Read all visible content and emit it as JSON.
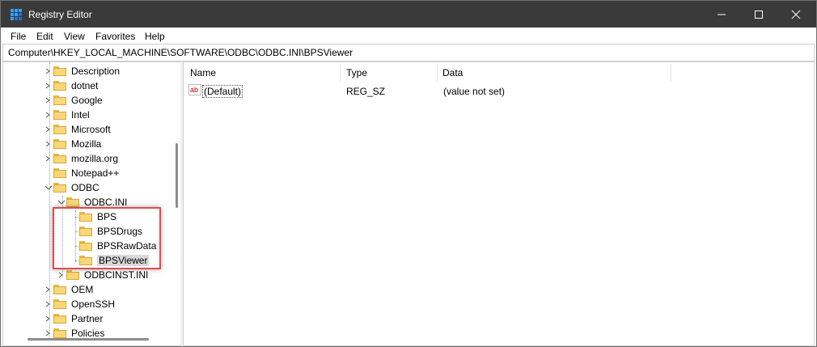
{
  "window": {
    "title": "Registry Editor"
  },
  "menu": [
    "File",
    "Edit",
    "View",
    "Favorites",
    "Help"
  ],
  "address": {
    "path": "Computer\\HKEY_LOCAL_MACHINE\\SOFTWARE\\ODBC\\ODBC.INI\\BPSViewer"
  },
  "tree": {
    "items": [
      {
        "label": "Description"
      },
      {
        "label": "dotnet"
      },
      {
        "label": "Google"
      },
      {
        "label": "Intel"
      },
      {
        "label": "Microsoft"
      },
      {
        "label": "Mozilla"
      },
      {
        "label": "mozilla.org"
      },
      {
        "label": "Notepad++"
      },
      {
        "label": "ODBC"
      },
      {
        "label": "ODBC.INI"
      },
      {
        "label": "BPS"
      },
      {
        "label": "BPSDrugs"
      },
      {
        "label": "BPSRawData"
      },
      {
        "label": "BPSViewer"
      },
      {
        "label": "ODBCINST.INI"
      },
      {
        "label": "OEM"
      },
      {
        "label": "OpenSSH"
      },
      {
        "label": "Partner"
      },
      {
        "label": "Policies"
      }
    ]
  },
  "list": {
    "headers": {
      "name": "Name",
      "type": "Type",
      "data": "Data"
    },
    "rows": [
      {
        "icon": "ab",
        "name": "(Default)",
        "type": "REG_SZ",
        "data": "(value not set)"
      }
    ]
  },
  "colors": {
    "titlebar": "#3a3a3a",
    "highlight": "#e04b4b",
    "folder": "#f7d77a",
    "selection": "#d9d9d9"
  }
}
